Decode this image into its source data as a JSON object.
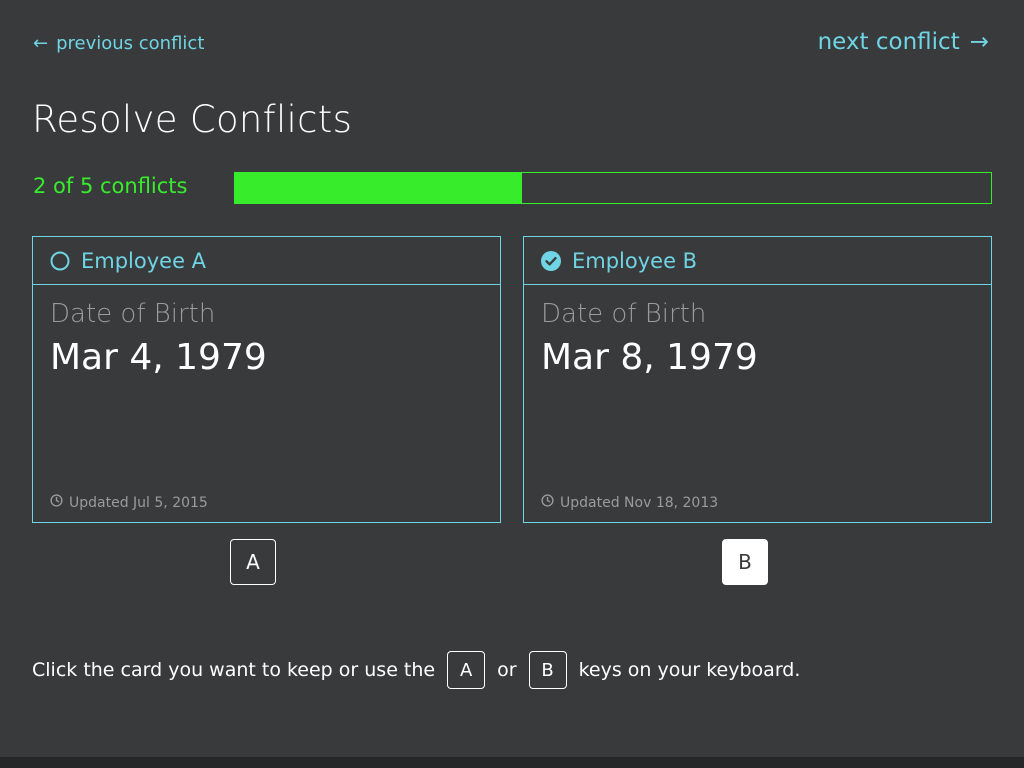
{
  "nav": {
    "previous_label": "previous conflict",
    "next_label": "next conflict",
    "left_arrow": "←",
    "right_arrow": "→"
  },
  "page": {
    "title": "Resolve Conflicts"
  },
  "progress": {
    "label": "2 of 5 conflicts",
    "current": 2,
    "total": 5,
    "fraction": 0.38,
    "color": "#37ec2b"
  },
  "cards": [
    {
      "title": "Employee A",
      "selected": false,
      "field_label": "Date of Birth",
      "value": "Mar 4, 1979",
      "updated": "Updated Jul 5, 2015",
      "key": "A"
    },
    {
      "title": "Employee B",
      "selected": true,
      "field_label": "Date of Birth",
      "value": "Mar 8, 1979",
      "updated": "Updated Nov 18, 2013",
      "key": "B"
    }
  ],
  "instructions": {
    "before": "Click the card you want to keep or use the",
    "key_a": "A",
    "middle": "or",
    "key_b": "B",
    "after": "keys on your keyboard."
  },
  "colors": {
    "background": "#393a3c",
    "accent": "#6fd4e4",
    "progress": "#37ec2b",
    "muted": "#9a9b9d"
  },
  "icons": {
    "previous": "arrow-left-icon",
    "next": "arrow-right-icon",
    "card_a_status": "radio-unchecked-icon",
    "card_b_status": "check-circle-icon",
    "updated": "clock-icon"
  }
}
